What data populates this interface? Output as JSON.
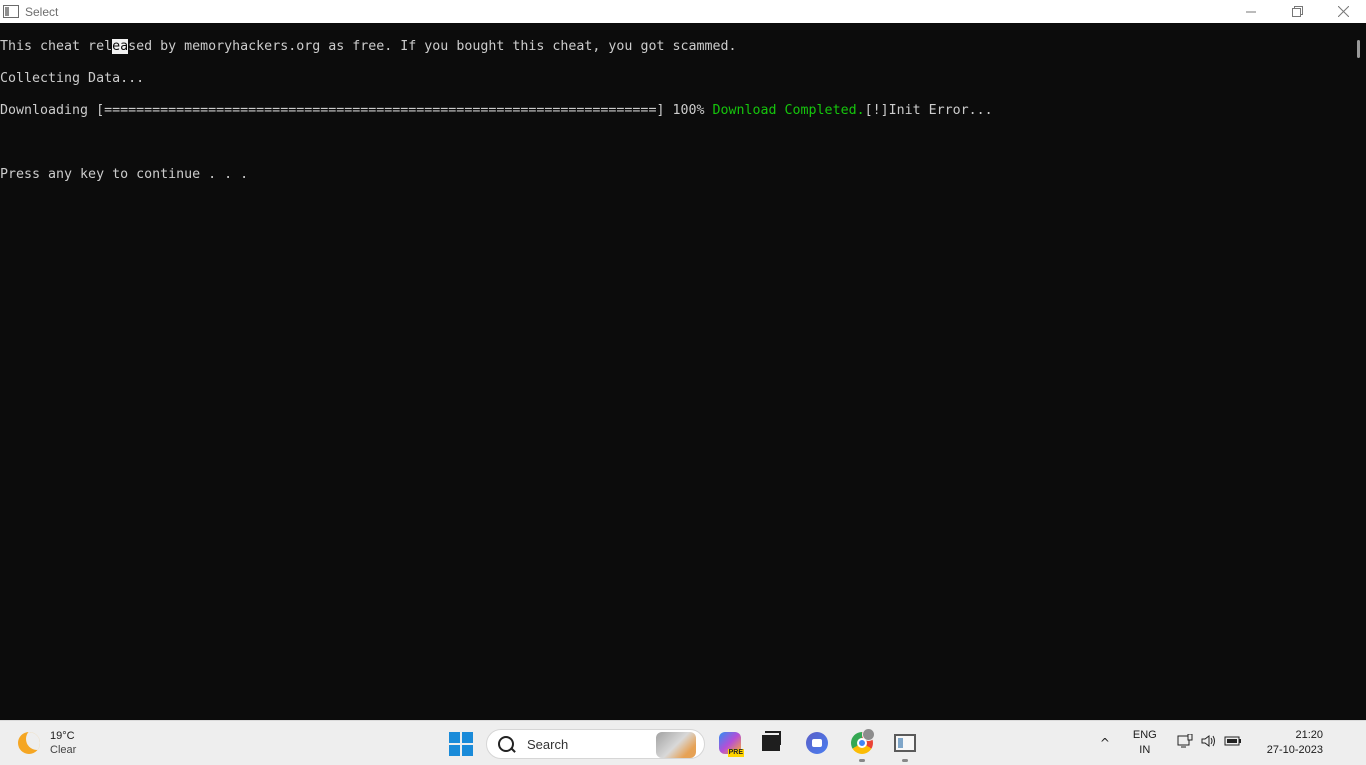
{
  "window": {
    "title": "Select",
    "controls": {
      "minimize": "—",
      "restore": "❐",
      "close": "✕"
    }
  },
  "terminal": {
    "line1_pre": "This cheat rel",
    "line1_cursor": "ea",
    "line1_post": "sed by memoryhackers.org as free. If you bought this cheat, you got scammed.",
    "line2": "Collecting Data...",
    "line3_progress": "Downloading [=====================================================================] 100% ",
    "line3_complete": "Download Completed.",
    "line3_error": "[!]Init Error...",
    "line4": "",
    "line5": "Press any key to continue . . ."
  },
  "taskbar": {
    "weather": {
      "temp": "19°C",
      "condition": "Clear",
      "icon": "moon-icon"
    },
    "search": {
      "label": "Search"
    },
    "apps": [
      "windows-start-icon",
      "copilot-icon",
      "task-view-icon",
      "meet-icon",
      "chrome-icon",
      "console-icon"
    ],
    "copilot_badge": "PRE",
    "tray": {
      "chevron": "^",
      "lang_line1": "ENG",
      "lang_line2": "IN",
      "time": "21:20",
      "date": "27-10-2023"
    }
  },
  "colors": {
    "terminal_bg": "#0c0c0c",
    "terminal_fg": "#cccccc",
    "success_green": "#16c60c",
    "start_blue": "#1a8bd9"
  }
}
